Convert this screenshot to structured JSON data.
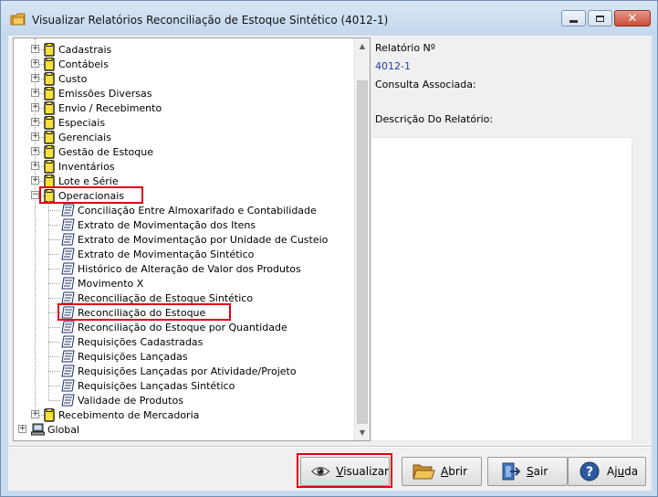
{
  "window": {
    "title": "Visualizar Relatórios Reconciliação de Estoque Sintético (4012-1)",
    "controls": {
      "close": "✕"
    }
  },
  "tree": {
    "top_folders": [
      {
        "label": "Cadastrais"
      },
      {
        "label": "Contábeis"
      },
      {
        "label": "Custo"
      },
      {
        "label": "Emissões Diversas"
      },
      {
        "label": "Envio / Recebimento"
      },
      {
        "label": "Especiais"
      },
      {
        "label": "Gerenciais"
      },
      {
        "label": "Gestão de Estoque"
      },
      {
        "label": "Inventários"
      },
      {
        "label": "Lote e Série"
      }
    ],
    "expanded_folder": {
      "label": "Operacionais",
      "toggle": "−"
    },
    "reports": [
      {
        "label": "Conciliação Entre Almoxarifado e Contabilidade"
      },
      {
        "label": "Extrato de Movimentação dos Itens"
      },
      {
        "label": "Extrato de Movimentação por Unidade de Custeio"
      },
      {
        "label": "Extrato de Movimentação Sintético"
      },
      {
        "label": "Histórico de Alteração de Valor dos Produtos"
      },
      {
        "label": "Movimento X"
      },
      {
        "label": "Reconciliação de Estoque Sintético"
      },
      {
        "label": "Reconciliação do Estoque"
      },
      {
        "label": "Reconciliação do Estoque por Quantidade"
      },
      {
        "label": "Requisições Cadastradas"
      },
      {
        "label": "Requisições Lançadas"
      },
      {
        "label": "Requisições Lançadas por Atividade/Projeto"
      },
      {
        "label": "Requisições Lançadas Sintético"
      },
      {
        "label": "Validade de Produtos"
      }
    ],
    "after_folder": {
      "label": "Recebimento de Mercadoria"
    },
    "root_global": {
      "label": "Global"
    },
    "toggle_plus": "+"
  },
  "info": {
    "report_number_label": "Relatório Nº",
    "report_number_value": "4012-1",
    "associated_query_label": "Consulta Associada:",
    "description_label": "Descrição Do Relatório:"
  },
  "buttons": {
    "visualizar": {
      "pre": "",
      "ul": "V",
      "post": "isualizar"
    },
    "abrir": {
      "pre": "",
      "ul": "A",
      "post": "brir"
    },
    "sair": {
      "pre": "",
      "ul": "S",
      "post": "air"
    },
    "ajuda": {
      "pre": "Aj",
      "ul": "u",
      "post": "da"
    }
  },
  "colors": {
    "highlight": "#e0000f",
    "link_blue": "#1d3fa6",
    "folder_yellow": "#f6e13a"
  }
}
